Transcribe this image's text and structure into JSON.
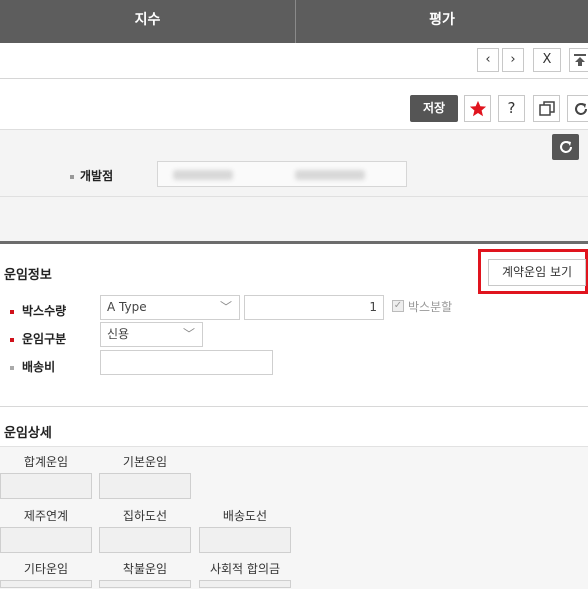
{
  "topnav": {
    "tab1": "지수",
    "tab2": "평가"
  },
  "window_controls": {
    "prev": "‹",
    "next": "›",
    "close": "X",
    "top": "⇡"
  },
  "toolbar": {
    "save_label": "저장",
    "help_label": "?"
  },
  "filter": {
    "branch_label": "개발점"
  },
  "freight_info": {
    "title": "운임정보",
    "contract_button": "계약운임 보기",
    "box_qty_label": "박스수량",
    "box_type_value": "A Type",
    "box_qty_value": "1",
    "box_split_label": "박스분할",
    "freight_type_label": "운임구분",
    "freight_type_value": "신용",
    "shipping_fee_label": "배송비",
    "shipping_fee_value": ""
  },
  "freight_detail": {
    "title": "운임상세",
    "fields": [
      "합계운임",
      "기본운임",
      "제주연계",
      "집하도선",
      "배송도선",
      "기타운임",
      "착불운임",
      "사회적 합의금"
    ]
  },
  "colors": {
    "accent_red": "#e0141e",
    "nav_bg": "#5d5d5d",
    "save_bg": "#555555"
  }
}
